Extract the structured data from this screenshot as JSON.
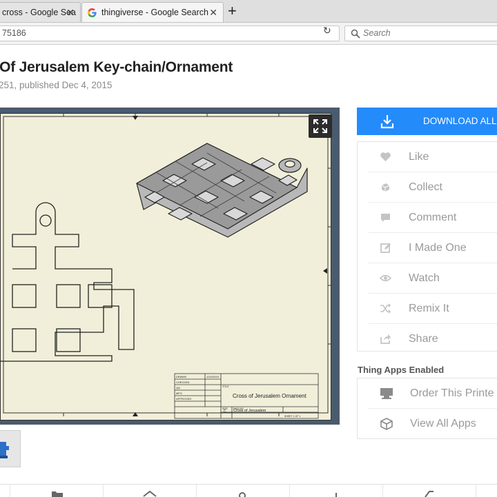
{
  "browser": {
    "tabs": [
      {
        "label": "cross - Google Sea",
        "active": false
      },
      {
        "label": "thingiverse - Google Search",
        "active": true
      }
    ],
    "new_tab_icon": "plus-icon",
    "url_text": "75186",
    "search_placeholder": "Search"
  },
  "thing": {
    "title": "s Of Jerusalem Key-chain/Ornament",
    "subtitle": "251, published Dec 4, 2015"
  },
  "drawing": {
    "title_block_title": "Cross of Jerusalem Ornament",
    "part_name": "Cross of Jerusalem",
    "size": "C",
    "sheet": "SHEET 1 OF 1",
    "date": "12/4/2015",
    "block_labels": [
      "DRAWN",
      "CHECKED",
      "QA",
      "MFG",
      "APPROVED"
    ],
    "title_label": "TITLE",
    "size_label": "SIZE",
    "dwg_label": "DWG NO"
  },
  "sidebar": {
    "download_label": "DOWNLOAD ALL",
    "actions": [
      {
        "label": "Like",
        "icon": "heart-icon"
      },
      {
        "label": "Collect",
        "icon": "collect-icon"
      },
      {
        "label": "Comment",
        "icon": "comment-icon"
      },
      {
        "label": "I Made One",
        "icon": "edit-icon"
      },
      {
        "label": "Watch",
        "icon": "eye-icon"
      },
      {
        "label": "Remix It",
        "icon": "shuffle-icon"
      },
      {
        "label": "Share",
        "icon": "share-icon"
      }
    ],
    "apps_heading": "Thing Apps Enabled",
    "apps": [
      {
        "label": "Order This Printe",
        "icon": "printer-icon"
      },
      {
        "label": "View All Apps",
        "icon": "cube-icon"
      }
    ]
  },
  "colors": {
    "accent": "#248bfb",
    "viewer_bg": "#4a5b6e",
    "paper": "#f1efd9"
  }
}
